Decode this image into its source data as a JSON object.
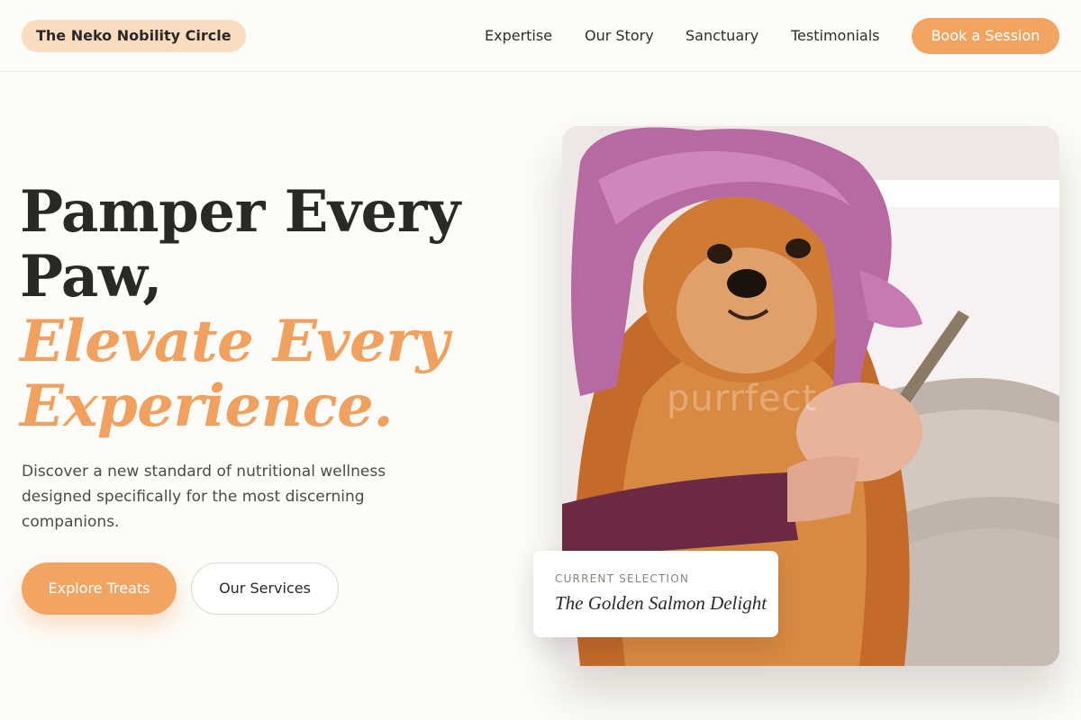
{
  "header": {
    "brand": "The Neko Nobility Circle",
    "nav": [
      {
        "label": "Expertise"
      },
      {
        "label": "Our Story"
      },
      {
        "label": "Sanctuary"
      },
      {
        "label": "Testimonials"
      }
    ],
    "cta": "Book a Session"
  },
  "hero": {
    "title_line1": "Pamper Every",
    "title_line2": "Paw,",
    "title_accent_line1": "Elevate Every",
    "title_accent_line2": "Experience.",
    "description": "Discover a new standard of nutritional wellness designed specifically for the most discerning companions.",
    "primary_button": "Explore Treats",
    "secondary_button": "Our Services",
    "image_watermark": "purrfect"
  },
  "selection_card": {
    "label": "CURRENT SELECTION",
    "title": "The Golden Salmon Delight"
  },
  "colors": {
    "accent": "#f2a463",
    "brand_pill": "#fbdcc0",
    "background": "#fdfcf8",
    "text": "#2b2926"
  }
}
